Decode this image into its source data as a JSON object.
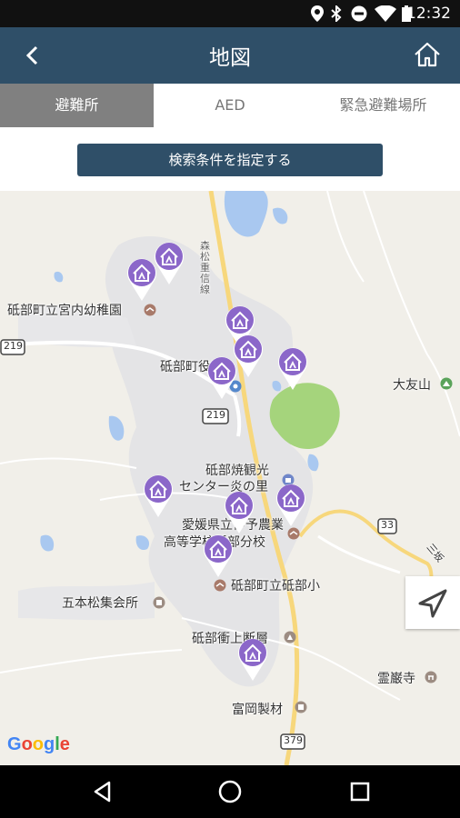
{
  "status_bar": {
    "time": "12:32",
    "icons": [
      "location-icon",
      "bluetooth-icon",
      "do-not-disturb-icon",
      "wifi-icon",
      "battery-icon"
    ]
  },
  "app_bar": {
    "title": "地図",
    "back_icon": "back-chevron-icon",
    "home_icon": "home-icon",
    "color": "#2f4f68"
  },
  "tabs": [
    {
      "label": "避難所",
      "active": true
    },
    {
      "label": "AED",
      "active": false
    },
    {
      "label": "緊急避難場所",
      "active": false
    }
  ],
  "filter_button": {
    "label": "検索条件を指定する"
  },
  "map": {
    "labels": {
      "kindergarten": "砥部町立宮内幼稚園",
      "town_office": "砥部町役場",
      "ceramics_center_1": "砥部焼観光",
      "ceramics_center_2": "センター炎の里",
      "high_school_1": "愛媛県立伊予農業",
      "high_school_2": "高等学校砥部分校",
      "elementary": "砥部町立砥部小",
      "gomatsu_hall": "五本松集会所",
      "oka_layer": "砥部衝上断層",
      "otomo_mountain": "大友山",
      "reiganji": "霊巌寺",
      "tomioka": "富岡製材",
      "road_219a": "219",
      "road_219b": "219",
      "road_33": "33",
      "road_379": "379",
      "road_name": "三坂",
      "vertical_road": "森松重信線"
    },
    "pin_icon": "shelter-pin-icon",
    "pin_color": "#8b67c9",
    "pin_count": 11,
    "google_logo": "Google",
    "my_location_icon": "navigation-arrow-icon"
  },
  "nav_bar": {
    "icons": [
      "back-triangle-icon",
      "home-circle-icon",
      "recents-square-icon"
    ]
  }
}
